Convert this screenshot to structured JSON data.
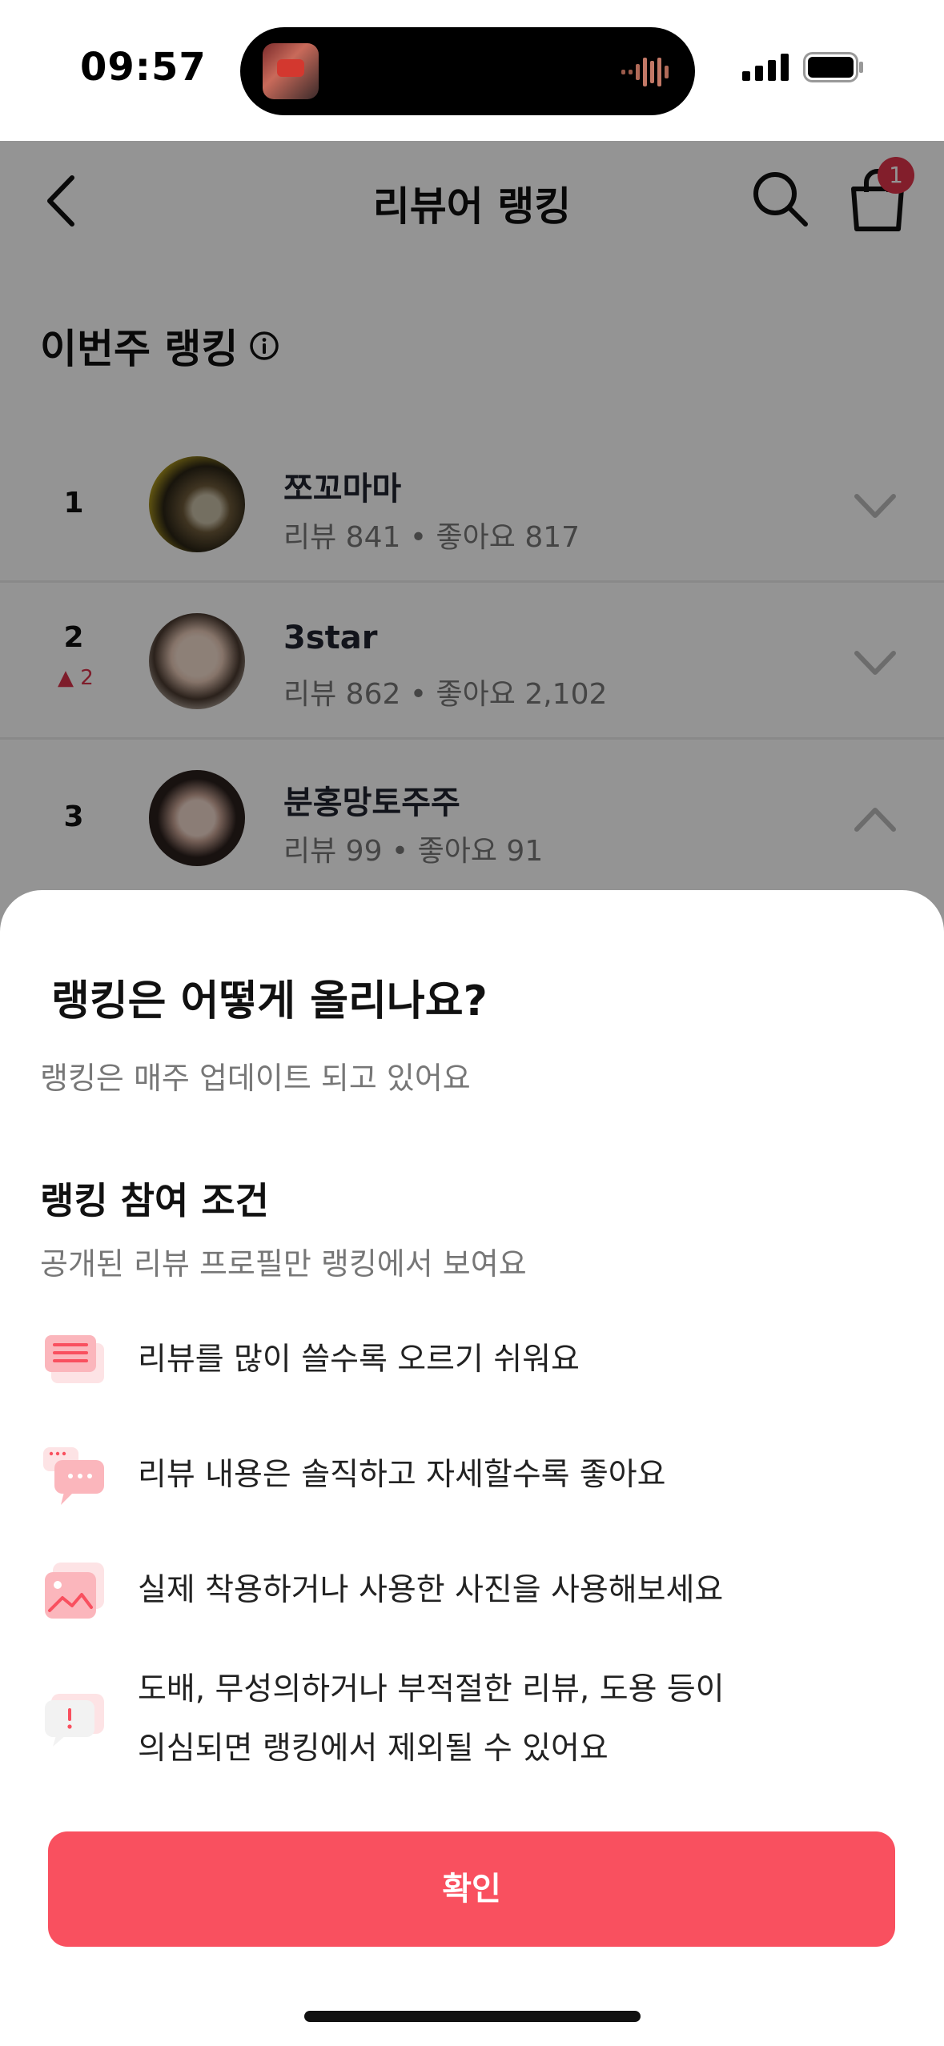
{
  "status_bar": {
    "time": "09:57"
  },
  "nav": {
    "title": "리뷰어 랭킹",
    "cart_count": "1"
  },
  "section": {
    "title": "이번주 랭킹"
  },
  "ranking": [
    {
      "rank": "1",
      "change": "",
      "name": "쪼꼬마마",
      "meta": "리뷰 841 • 좋아요 817",
      "expanded": false
    },
    {
      "rank": "2",
      "change": "2",
      "name": "3star",
      "meta": "리뷰 862 • 좋아요 2,102",
      "expanded": false
    },
    {
      "rank": "3",
      "change": "",
      "name": "분홍망토주주",
      "meta": "리뷰 99 • 좋아요 91",
      "expanded": true
    }
  ],
  "sheet": {
    "title": "랭킹은 어떻게 올리나요?",
    "subtitle": "랭킹은 매주 업데이트 되고 있어요",
    "conditions_title": "랭킹 참여 조건",
    "conditions_desc": "공개된 리뷰 프로필만 랭킹에서 보여요",
    "rules": [
      {
        "icon": "document-icon",
        "text": "리뷰를 많이 쓸수록 오르기 쉬워요"
      },
      {
        "icon": "chat-bubbles-icon",
        "text": "리뷰 내용은 솔직하고 자세할수록 좋아요"
      },
      {
        "icon": "photo-icon",
        "text": "실제 착용하거나 사용한 사진을 사용해보세요"
      },
      {
        "icon": "warning-bubble-icon",
        "text_line1": "도배, 무성의하거나 부적절한 리뷰, 도용 등이",
        "text_line2": "의심되면 랭킹에서 제외될 수 있어요"
      }
    ],
    "confirm_label": "확인"
  },
  "colors": {
    "accent": "#f9505f",
    "badge": "#e0344a",
    "rank_up": "#d9324a"
  }
}
